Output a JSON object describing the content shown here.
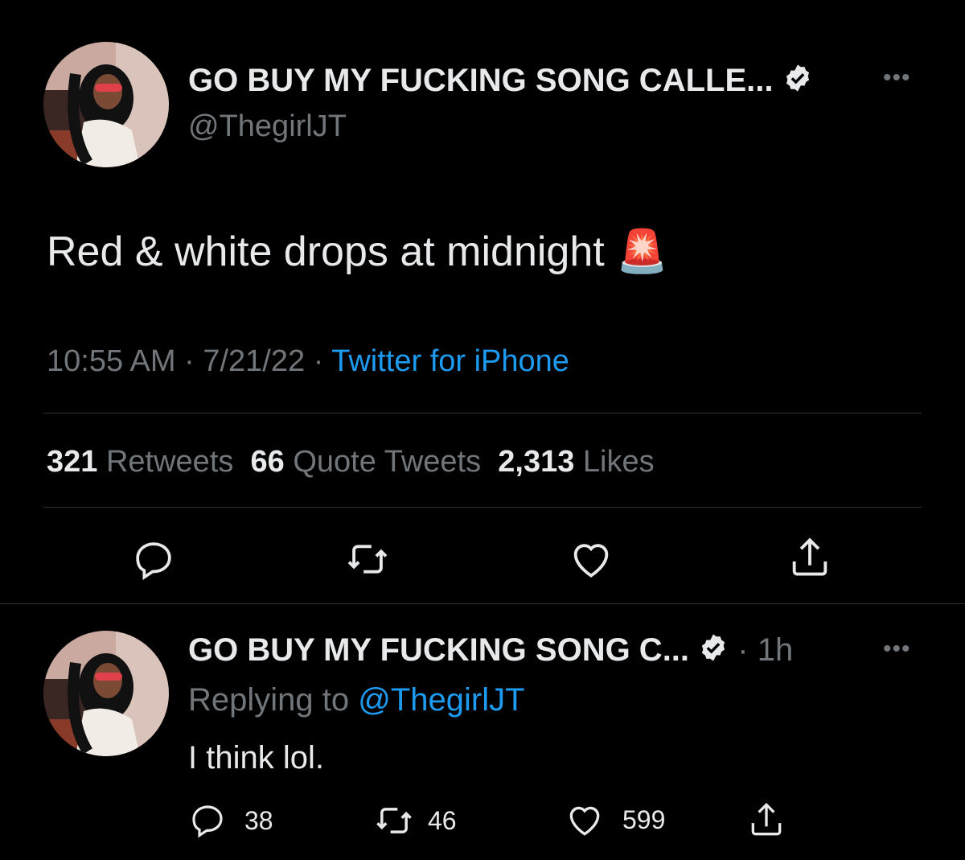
{
  "main_tweet": {
    "display_name": "GO BUY MY FUCKING SONG CALLE...",
    "handle": "@ThegirlJT",
    "text": "Red & white drops at midnight",
    "emoji": "🚨",
    "time": "10:55 AM",
    "date": "7/21/22",
    "separator": "·",
    "source": "Twitter for iPhone",
    "stats": {
      "retweets_count": "321",
      "retweets_label": "Retweets",
      "quotes_count": "66",
      "quotes_label": "Quote Tweets",
      "likes_count": "2,313",
      "likes_label": "Likes"
    },
    "actions": [
      "reply-icon",
      "retweet-icon",
      "like-icon",
      "share-icon"
    ]
  },
  "reply_tweet": {
    "display_name": "GO BUY MY FUCKING SONG C...",
    "separator": "·",
    "age": "1h",
    "replying_prefix": "Replying to",
    "replying_handle": "@ThegirlJT",
    "text": "I think lol.",
    "reply_count": "38",
    "retweet_count": "46",
    "like_count": "599"
  },
  "colors": {
    "background": "#000000",
    "text": "#e7e9ea",
    "muted": "#71767b",
    "link": "#1d9bf0",
    "divider": "#2f3336"
  }
}
